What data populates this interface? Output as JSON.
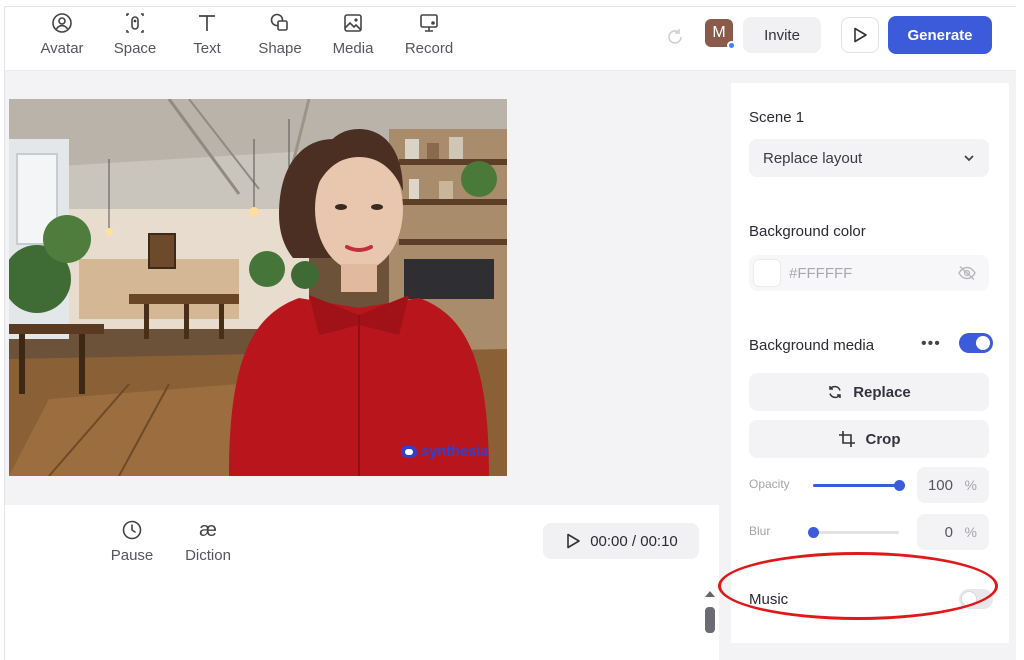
{
  "toolbar": {
    "tools": [
      {
        "label": "Avatar",
        "icon": "avatar-icon"
      },
      {
        "label": "Space",
        "icon": "space-icon"
      },
      {
        "label": "Text",
        "icon": "text-icon"
      },
      {
        "label": "Shape",
        "icon": "shape-icon"
      },
      {
        "label": "Media",
        "icon": "media-icon"
      },
      {
        "label": "Record",
        "icon": "record-icon"
      }
    ],
    "user_initial": "M",
    "invite_label": "Invite",
    "generate_label": "Generate"
  },
  "canvas": {
    "watermark": "synthesia"
  },
  "timeline": {
    "tools": [
      {
        "label": "Pause",
        "icon": "clock-icon"
      },
      {
        "label": "Diction",
        "icon": "ae-ligature-icon",
        "glyph": "æ"
      }
    ],
    "time_display": "00:00 / 00:10"
  },
  "panel": {
    "scene_title": "Scene 1",
    "layout_select": "Replace layout",
    "bg_color_title": "Background color",
    "bg_color_value": "#FFFFFF",
    "bg_media_title": "Background media",
    "bg_media_enabled": true,
    "replace_label": "Replace",
    "crop_label": "Crop",
    "opacity": {
      "label": "Opacity",
      "value": "100",
      "unit": "%",
      "fraction": 1.0
    },
    "blur": {
      "label": "Blur",
      "value": "0",
      "unit": "%",
      "fraction": 0.0
    },
    "music_title": "Music",
    "music_enabled": false
  },
  "colors": {
    "accent": "#3b5bdb",
    "annotation": "#e0181a"
  }
}
